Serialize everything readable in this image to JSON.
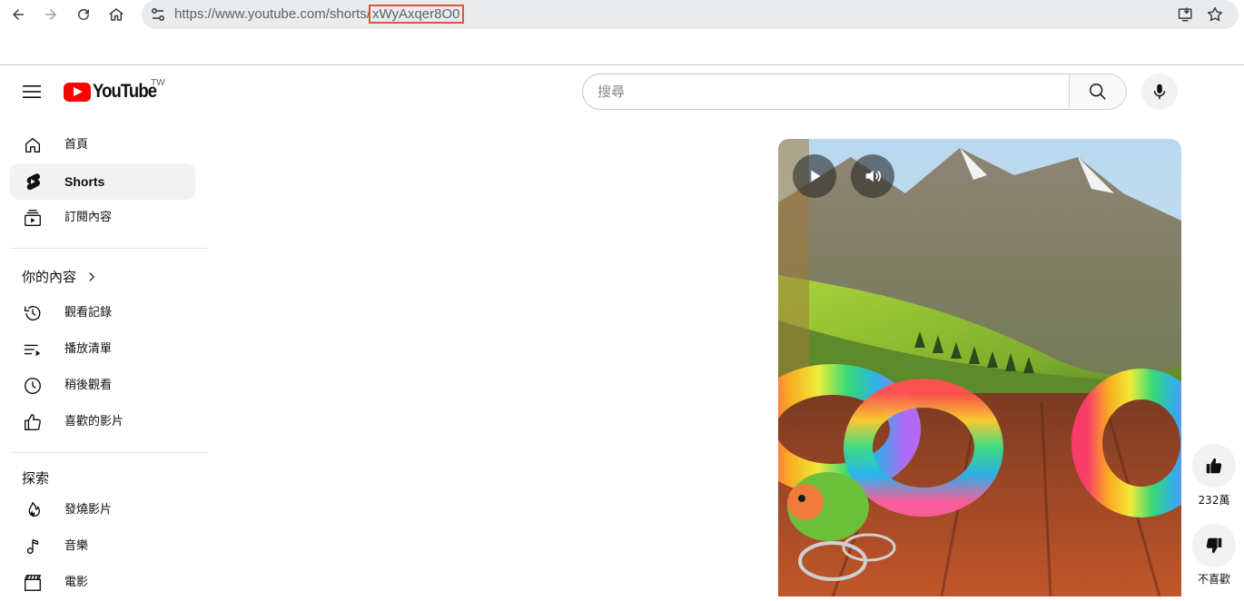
{
  "browser": {
    "url_prefix": "https://www.youtube.com/shorts/",
    "url_id": "xWyAxqer8O0"
  },
  "header": {
    "logo_text": "YouTube",
    "region": "TW",
    "search_placeholder": "搜尋"
  },
  "sidebar": {
    "main": [
      {
        "label": "首頁",
        "icon": "home-icon"
      },
      {
        "label": "Shorts",
        "icon": "shorts-icon",
        "active": true
      },
      {
        "label": "訂閱內容",
        "icon": "subscriptions-icon"
      }
    ],
    "you_title": "你的內容",
    "you": [
      {
        "label": "觀看記錄",
        "icon": "history-icon"
      },
      {
        "label": "播放清單",
        "icon": "playlist-icon"
      },
      {
        "label": "稍後觀看",
        "icon": "clock-icon"
      },
      {
        "label": "喜歡的影片",
        "icon": "thumbs-up-icon"
      }
    ],
    "explore_title": "探索",
    "explore": [
      {
        "label": "發燒影片",
        "icon": "trending-icon"
      },
      {
        "label": "音樂",
        "icon": "music-icon"
      },
      {
        "label": "電影",
        "icon": "film-icon"
      }
    ]
  },
  "short": {
    "like_count": "232萬",
    "dislike_label": "不喜歡"
  },
  "colors": {
    "accent": "#ff0000",
    "highlight_box": "#d9583f"
  }
}
